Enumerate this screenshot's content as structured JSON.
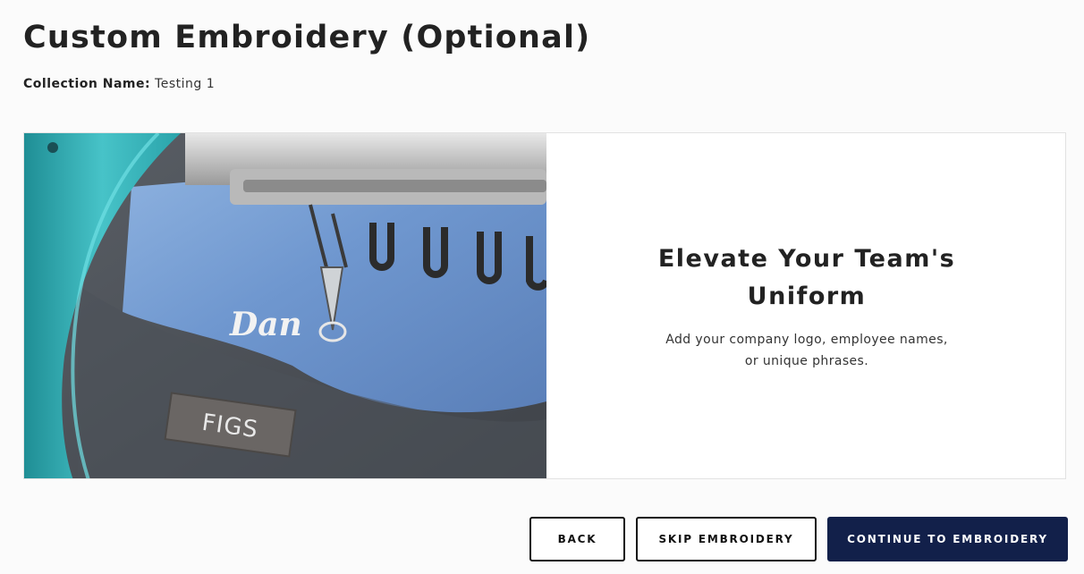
{
  "page": {
    "title": "Custom Embroidery (Optional)",
    "collection_label": "Collection Name:",
    "collection_value": "Testing 1"
  },
  "hero": {
    "image_label": "FIGS",
    "embroidered_text": "Dan",
    "heading_line1": "Elevate Your Team's",
    "heading_line2": "Uniform",
    "body_line1": "Add your company logo, employee names,",
    "body_line2": "or unique phrases."
  },
  "actions": {
    "back": "Back",
    "skip": "Skip Embroidery",
    "continue": "Continue to Embroidery"
  },
  "colors": {
    "primary_button": "#12204a",
    "outline_button_border": "#111111",
    "page_background": "#fbfbfb",
    "hoop": "#2fb0b5"
  }
}
